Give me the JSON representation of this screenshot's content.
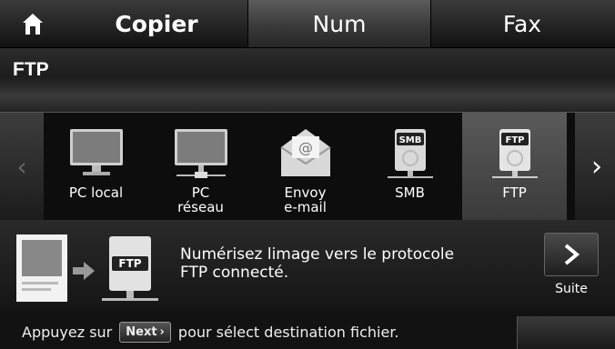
{
  "topbar": {
    "home_icon": "home-icon",
    "tabs": [
      {
        "label": "Copier",
        "active": false
      },
      {
        "label": "Num",
        "active": true
      },
      {
        "label": "Fax",
        "active": false
      }
    ]
  },
  "title": "FTP",
  "carousel": {
    "prev_icon": "chevron-left-icon",
    "next_icon": "chevron-right-icon",
    "items": [
      {
        "line1": "PC local",
        "line2": "",
        "icon": "monitor-icon"
      },
      {
        "line1": "PC",
        "line2": "réseau",
        "icon": "network-monitor-icon"
      },
      {
        "line1": "Envoy",
        "line2": "e-mail",
        "icon": "envelope-icon"
      },
      {
        "line1": "SMB",
        "line2": "",
        "icon": "smb-server-icon",
        "badge": "SMB"
      },
      {
        "line1": "FTP",
        "line2": "",
        "icon": "ftp-server-icon",
        "badge": "FTP",
        "selected": true
      }
    ]
  },
  "info": {
    "badge": "FTP",
    "line1": "Numérisez limage vers le protocole",
    "line2": "FTP connecté.",
    "suite_label": "Suite"
  },
  "bottom": {
    "hint_before": "Appuyez sur",
    "next_key": "Next",
    "hint_after": "pour sélect destination fichier."
  },
  "colors": {
    "background": "#1a1a1a",
    "selected_item": "#4a4a4a",
    "text": "#ffffff"
  }
}
